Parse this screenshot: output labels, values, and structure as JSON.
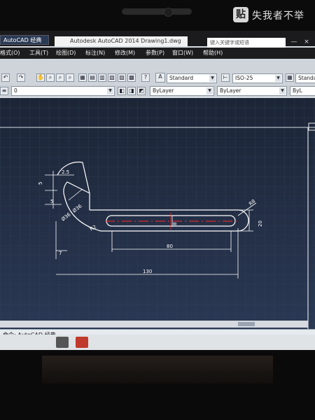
{
  "watermark": {
    "icon": "贴",
    "text": "失我者不举"
  },
  "titlebar": {
    "workspace": "AutoCAD 经典",
    "app_title": "Autodesk AutoCAD 2014    Drawing1.dwg",
    "search_placeholder": "键入关键字或短语",
    "window_controls": [
      "—",
      "×"
    ]
  },
  "menubar": {
    "items": [
      "格式(O)",
      "工具(T)",
      "绘图(D)",
      "标注(N)",
      "修改(M)",
      "参数(P)",
      "窗口(W)",
      "帮助(H)"
    ]
  },
  "toolbar": {
    "text_style": "Standard",
    "dim_style": "ISO-25",
    "table_style": "Standard",
    "layer": "0",
    "color": "ByLayer",
    "linetype": "ByLayer",
    "lineweight": "ByL"
  },
  "drawing": {
    "dimensions": {
      "d_2_5": "2.5",
      "d_5a": "5",
      "d_5b": "5",
      "dia_36": "Ø36",
      "dia_36b": "Ø36",
      "r2": "R2",
      "r8": "R8",
      "h_8": "8",
      "h_20": "20",
      "d_7": "7",
      "d_80": "80",
      "d_130": "130"
    }
  },
  "cmdline": {
    "text": "命令: AutoCAD 经典"
  },
  "colors": {
    "drawing_bg": "#243046",
    "lines": "#ffffff",
    "centerline": "#ff2020"
  }
}
